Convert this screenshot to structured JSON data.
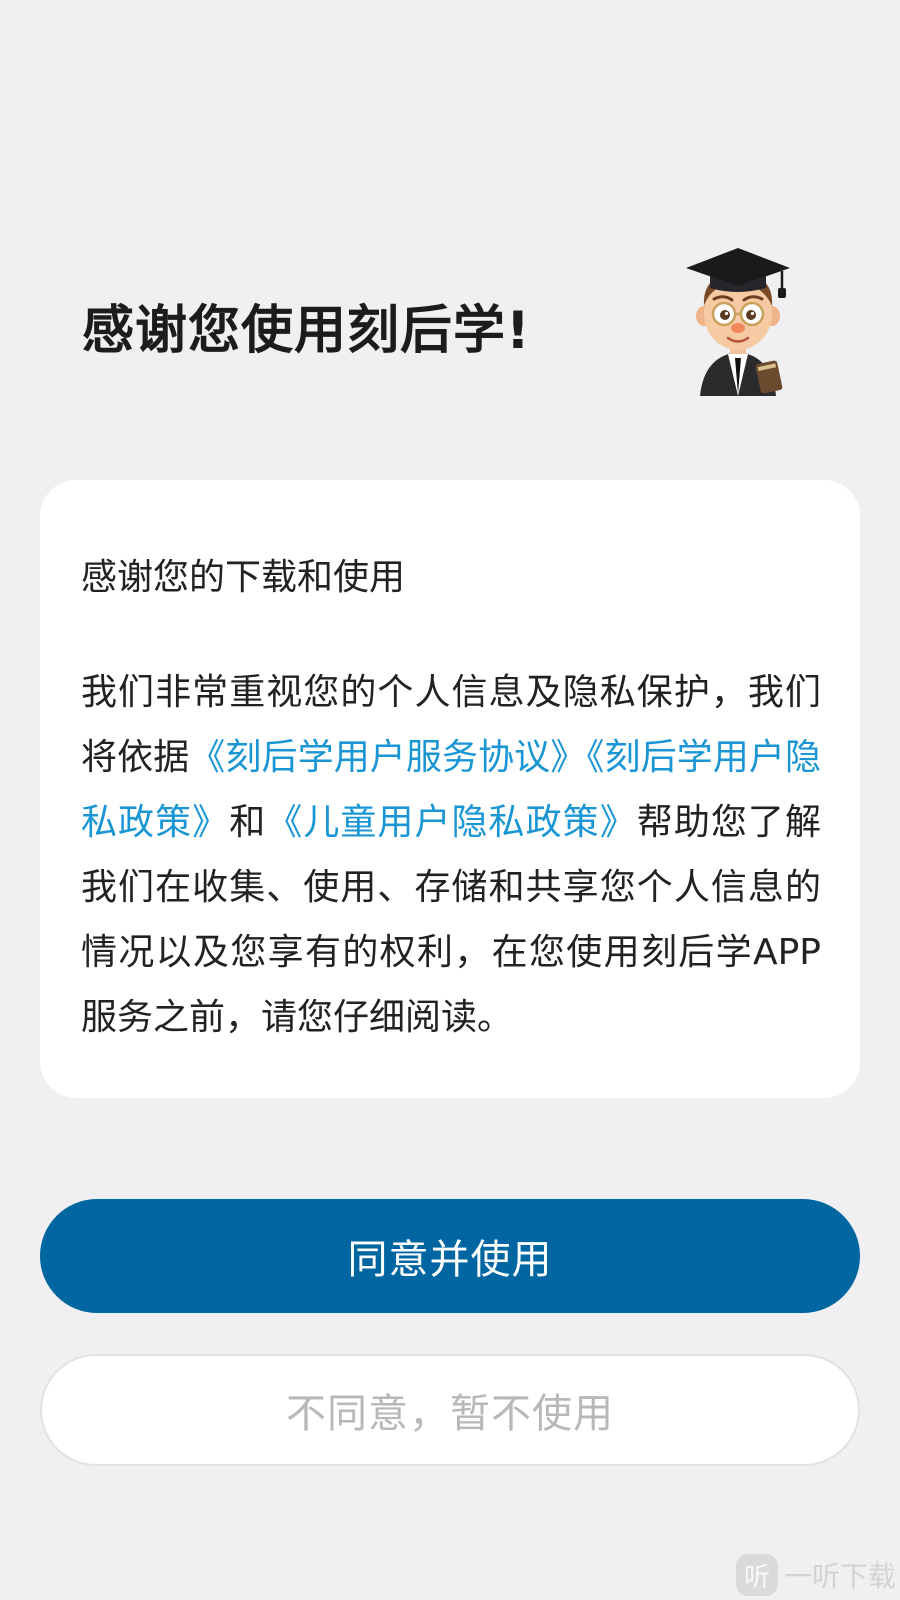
{
  "header": {
    "title": "感谢您使用刻后学!",
    "mascot_icon": "student-mascot-icon"
  },
  "card": {
    "greeting": "感谢您的下载和使用",
    "body_part1": "我们非常重视您的个人信息及隐私保护，我们将依据",
    "link_service_agreement": "《刻后学用户服务协议》",
    "link_privacy_policy": "《刻后学用户隐私政策》",
    "conjunction": "和",
    "link_children_privacy": "《儿童用户隐私政策》",
    "body_part2": "帮助您了解我们在收集、使用、存储和共享您个人信息的情况以及您享有的权利，在您使用刻后学APP服务之前，请您仔细阅读。",
    "link_color": "#1a96d4"
  },
  "buttons": {
    "agree_label": "同意并使用",
    "disagree_label": "不同意，暂不使用",
    "agree_color": "#0066a2"
  },
  "watermark": {
    "logo_glyph": "听",
    "text": "一听下载"
  }
}
